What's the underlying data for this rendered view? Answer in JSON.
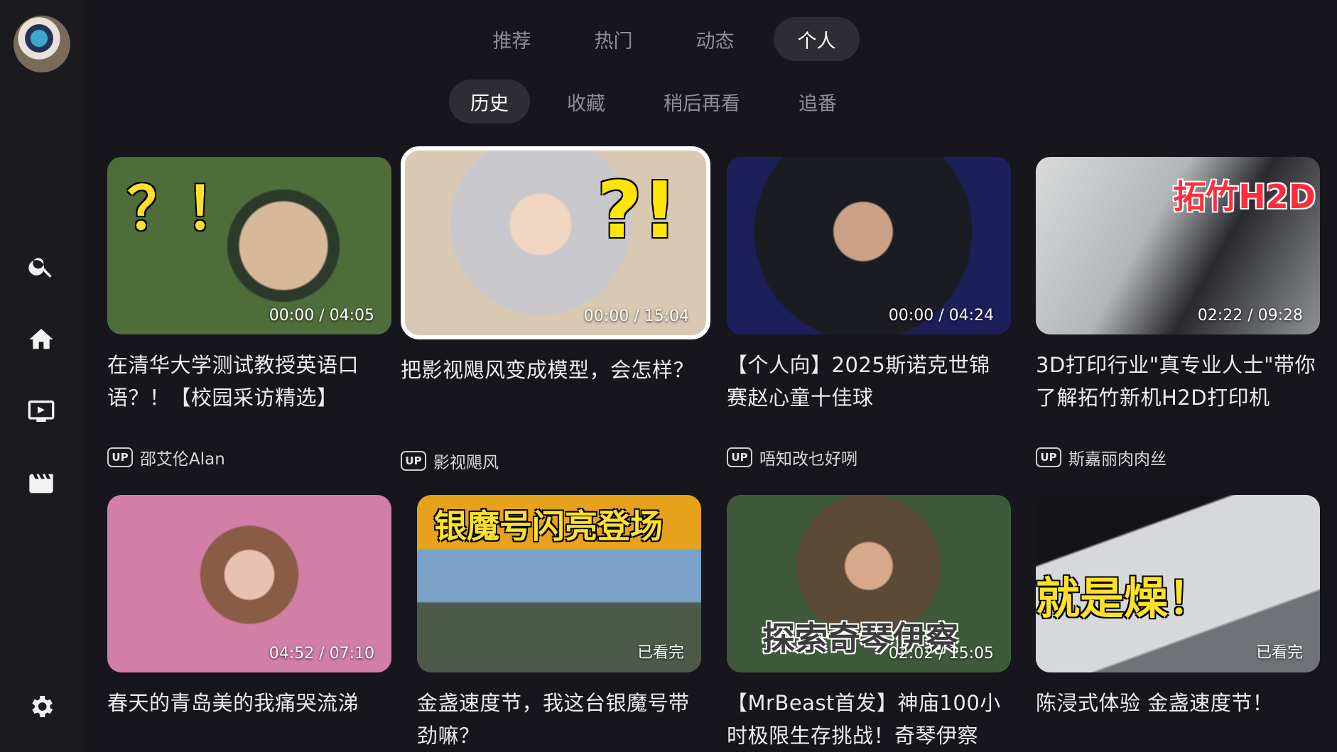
{
  "top_tabs": [
    "推荐",
    "热门",
    "动态",
    "个人"
  ],
  "top_tab_active": "个人",
  "sub_tabs": [
    "历史",
    "收藏",
    "稍后再看",
    "追番"
  ],
  "sub_tab_active": "历史",
  "sidebar": {
    "icons": [
      "search-icon",
      "home-icon",
      "tv-icon",
      "clapperboard-icon",
      "gear-icon"
    ]
  },
  "up_badge": "UP",
  "cards": [
    {
      "title": "在清华大学测试教授英语口语？！【校园采访精选】",
      "time": "00:00 / 04:05",
      "uploader": "邵艾伦Alan",
      "overlay": "？！"
    },
    {
      "title": "把影视飓风变成模型，会怎样？",
      "time": "00:00 / 15:04",
      "uploader": "影视飓风",
      "overlay": "?!"
    },
    {
      "title": "【个人向】2025斯诺克世锦赛赵心童十佳球",
      "time": "00:00 / 04:24",
      "uploader": "唔知改乜好咧",
      "overlay": ""
    },
    {
      "title": "3D打印行业\"真专业人士\"带你了解拓竹新机H2D打印机",
      "time": "02:22 / 09:28",
      "uploader": "斯嘉丽肉肉丝",
      "overlay": "拓竹H2D"
    },
    {
      "title": "春天的青岛美的我痛哭流涕",
      "time": "04:52 / 07:10",
      "uploader": "",
      "overlay": ""
    },
    {
      "title": "金盏速度节，我这台银魔号带劲嘛？",
      "time": "已看完",
      "uploader": "",
      "overlay": "银魔号闪亮登场"
    },
    {
      "title": "【MrBeast首发】神庙100小时极限生存挑战！奇琴伊察",
      "time": "02:02 / 15:05",
      "uploader": "",
      "overlay": "探索奇琴伊察"
    },
    {
      "title": "陈浸式体验 金盏速度节！",
      "time": "已看完",
      "uploader": "",
      "overlay": "就是燥！"
    }
  ]
}
